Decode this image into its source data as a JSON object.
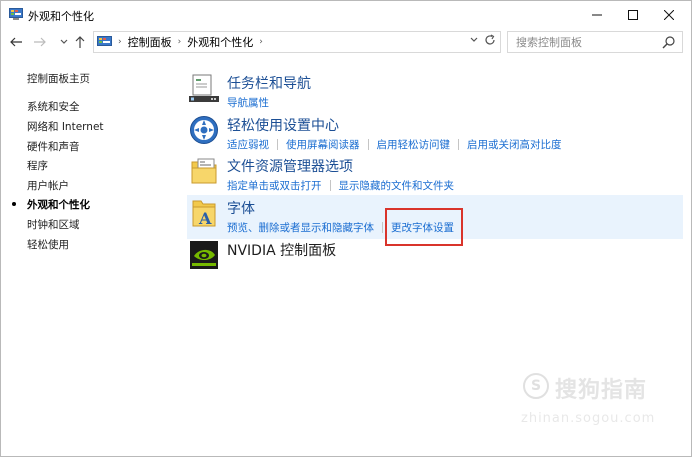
{
  "window": {
    "title": "外观和个性化",
    "controls": {
      "minimize": "—",
      "maximize": "☐",
      "close": "✕"
    }
  },
  "address_bar": {
    "breadcrumbs": [
      "控制面板",
      "外观和个性化"
    ],
    "search_placeholder": "搜索控制面板"
  },
  "sidebar": {
    "items": [
      {
        "label": "控制面板主页",
        "active": false
      },
      {
        "label": "系统和安全",
        "active": false
      },
      {
        "label": "网络和 Internet",
        "active": false
      },
      {
        "label": "硬件和声音",
        "active": false
      },
      {
        "label": "程序",
        "active": false
      },
      {
        "label": "用户帐户",
        "active": false
      },
      {
        "label": "外观和个性化",
        "active": true
      },
      {
        "label": "时钟和区域",
        "active": false
      },
      {
        "label": "轻松使用",
        "active": false
      }
    ]
  },
  "categories": [
    {
      "title": "任务栏和导航",
      "icon": "taskbar-icon",
      "links": [
        "导航属性"
      ]
    },
    {
      "title": "轻松使用设置中心",
      "icon": "ease-of-access-icon",
      "links": [
        "适应弱视",
        "使用屏幕阅读器",
        "启用轻松访问键",
        "启用或关闭高对比度"
      ]
    },
    {
      "title": "文件资源管理器选项",
      "icon": "folder-options-icon",
      "links": [
        "指定单击或双击打开",
        "显示隐藏的文件和文件夹"
      ]
    },
    {
      "title": "字体",
      "icon": "fonts-icon",
      "links": [
        "预览、删除或者显示和隐藏字体",
        "更改字体设置"
      ],
      "highlighted": true
    },
    {
      "title": "NVIDIA 控制面板",
      "icon": "nvidia-icon",
      "links": []
    }
  ],
  "watermark": {
    "text": "搜狗指南",
    "sub": "zhinan.sogou.com"
  },
  "colors": {
    "link": "#1a6dd1",
    "category_title": "#1c4f95",
    "highlight_border": "#d9342b",
    "hover_row": "#e9f3fd"
  }
}
